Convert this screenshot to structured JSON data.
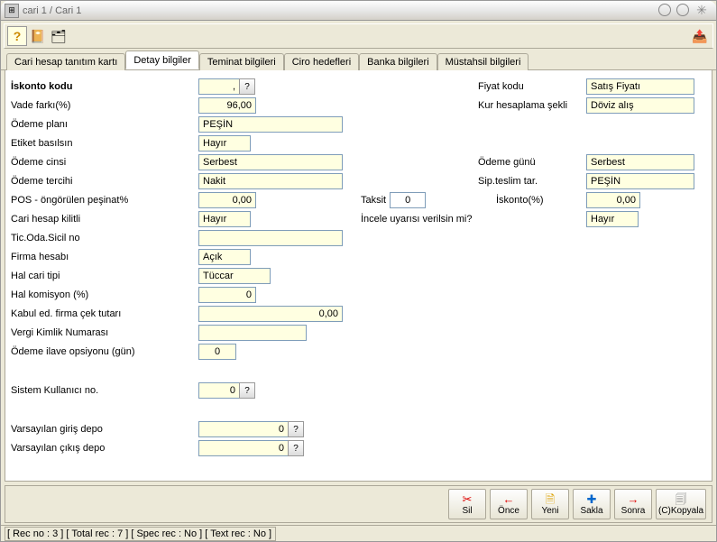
{
  "window": {
    "title": "cari 1 / Cari 1"
  },
  "tabs": [
    {
      "label": "Cari hesap tanıtım kartı"
    },
    {
      "label": "Detay bilgiler"
    },
    {
      "label": "Teminat bilgileri"
    },
    {
      "label": "Ciro hedefleri"
    },
    {
      "label": "Banka bilgileri"
    },
    {
      "label": "Müstahsil bilgileri"
    }
  ],
  "labels": {
    "iskonto_kodu": "İskonto kodu",
    "fiyat_kodu": "Fiyat kodu",
    "vade_farki": "Vade farkı(%)",
    "kur_hesap": "Kur hesaplama şekli",
    "odeme_plani": "Ödeme planı",
    "etiket": "Etiket basılsın",
    "odeme_cinsi": "Ödeme cinsi",
    "odeme_gunu": "Ödeme günü",
    "odeme_tercihi": "Ödeme tercihi",
    "sip_teslim": "Sip.teslim tar.",
    "pos_pesinat": "POS - öngörülen peşinat%",
    "taksit": "Taksit",
    "iskonto_pct": "İskonto(%)",
    "cari_kilitli": "Cari hesap kilitli",
    "incele_uyari": "İncele uyarısı verilsin mi?",
    "tic_oda": "Tic.Oda.Sicil no",
    "firma_hesabi": "Firma hesabı",
    "hal_cari": "Hal cari tipi",
    "hal_komisyon": "Hal komisyon (%)",
    "kabul_cek": "Kabul ed. firma çek tutarı",
    "vergi_kimlik": "Vergi Kimlik Numarası",
    "odeme_ilave": "Ödeme ilave opsiyonu (gün)",
    "sistem_kullanici": "Sistem Kullanıcı no.",
    "varsayilan_giris": "Varsayılan giriş depo",
    "varsayilan_cikis": "Varsayılan çıkış depo"
  },
  "values": {
    "iskonto_kodu": ",",
    "fiyat_kodu": "Satış Fiyatı",
    "vade_farki": "96,00",
    "kur_hesap": "Döviz alış",
    "odeme_plani": "PEŞİN",
    "etiket": "Hayır",
    "odeme_cinsi": "Serbest",
    "odeme_gunu": "Serbest",
    "odeme_tercihi": "Nakit",
    "sip_teslim": "PEŞİN",
    "pos_pesinat": "0,00",
    "taksit": "0",
    "iskonto_pct": "0,00",
    "cari_kilitli": "Hayır",
    "incele_uyari": "Hayır",
    "tic_oda": "",
    "firma_hesabi": "Açık",
    "hal_cari": "Tüccar",
    "hal_komisyon": "0",
    "kabul_cek": "0,00",
    "vergi_kimlik": "",
    "odeme_ilave": "0",
    "sistem_kullanici": "0",
    "varsayilan_giris": "0",
    "varsayilan_cikis": "0"
  },
  "lookup_glyph": "?",
  "actions": {
    "sil": "Sil",
    "once": "Önce",
    "yeni": "Yeni",
    "sakla": "Sakla",
    "sonra": "Sonra",
    "kopyala": "(C)Kopyala"
  },
  "status": "[ Rec no : 3 ] [ Total rec : 7 ] [ Spec rec : No ] [ Text rec : No  ]"
}
